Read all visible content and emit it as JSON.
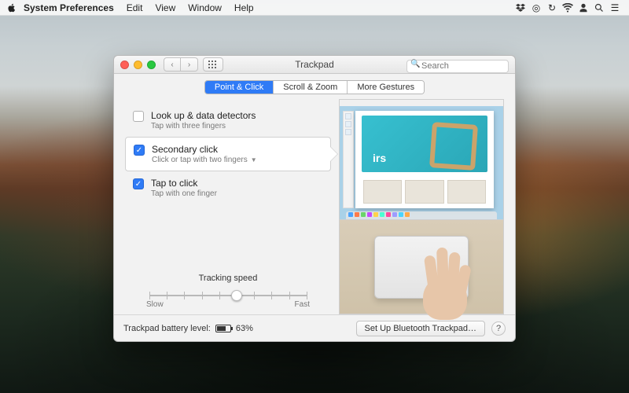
{
  "menubar": {
    "app": "System Preferences",
    "items": [
      "Edit",
      "View",
      "Window",
      "Help"
    ]
  },
  "window": {
    "title": "Trackpad",
    "search_placeholder": "Search"
  },
  "tabs": [
    {
      "label": "Point & Click",
      "active": true
    },
    {
      "label": "Scroll & Zoom",
      "active": false
    },
    {
      "label": "More Gestures",
      "active": false
    }
  ],
  "options": [
    {
      "title": "Look up & data detectors",
      "sub": "Tap with three fingers",
      "checked": false,
      "selected": false,
      "dropdown": false
    },
    {
      "title": "Secondary click",
      "sub": "Click or tap with two fingers",
      "checked": true,
      "selected": true,
      "dropdown": true
    },
    {
      "title": "Tap to click",
      "sub": "Tap with one finger",
      "checked": true,
      "selected": false,
      "dropdown": false
    }
  ],
  "tracking": {
    "label": "Tracking speed",
    "slow": "Slow",
    "fast": "Fast",
    "ticks": 10,
    "value_index": 5
  },
  "preview": {
    "caption": "irs"
  },
  "footer": {
    "battery_label": "Trackpad battery level:",
    "battery_pct": "63%",
    "bt_button": "Set Up Bluetooth Trackpad…",
    "help": "?"
  }
}
